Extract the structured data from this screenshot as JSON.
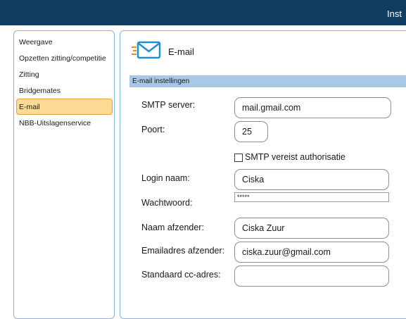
{
  "window": {
    "title": "Inst"
  },
  "sidebar": {
    "items": [
      {
        "label": "Weergave",
        "active": false
      },
      {
        "label": "Opzetten zitting/competitie",
        "active": false
      },
      {
        "label": "Zitting",
        "active": false
      },
      {
        "label": "Bridgemates",
        "active": false
      },
      {
        "label": "E-mail",
        "active": true
      },
      {
        "label": "NBB-Uitslagenservice",
        "active": false
      }
    ]
  },
  "header": {
    "title": "E-mail",
    "icon": "email-icon"
  },
  "section": {
    "title": "E-mail instellingen"
  },
  "form": {
    "smtp_server": {
      "label": "SMTP server:",
      "value": "mail.gmail.com"
    },
    "port": {
      "label": "Poort:",
      "value": "25"
    },
    "auth": {
      "label": "SMTP vereist authorisatie",
      "checked": false
    },
    "login": {
      "label": "Login naam:",
      "value": "Ciska"
    },
    "password": {
      "label": "Wachtwoord:",
      "value": "*****"
    },
    "sender_name": {
      "label": "Naam afzender:",
      "value": "Ciska Zuur"
    },
    "sender_email": {
      "label": "Emailadres afzender:",
      "value": "ciska.zuur@gmail.com"
    },
    "cc": {
      "label": "Standaard cc-adres:",
      "value": ""
    }
  },
  "colors": {
    "titlebar": "#0f3e62",
    "panel_border": "#8db4d8",
    "section_band": "#a9c7e6",
    "active_item": "#fcdc94",
    "active_item_border": "#e2a13a",
    "icon_blue": "#1f8fd4",
    "icon_orange": "#f08a1c"
  }
}
